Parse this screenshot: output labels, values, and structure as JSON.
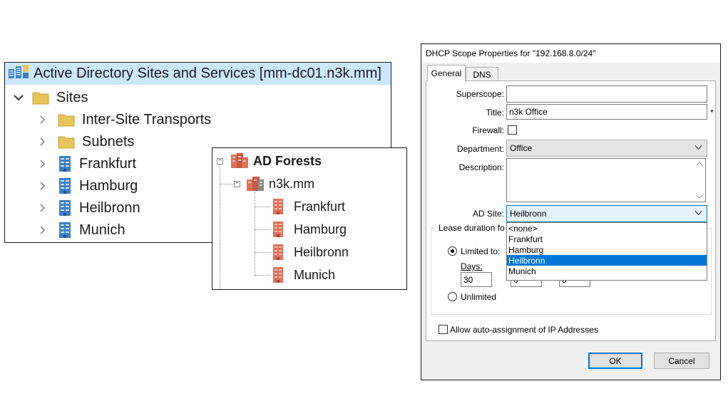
{
  "ads": {
    "title": "Active Directory Sites and Services [mm-dc01.n3k.mm]",
    "root": "Sites",
    "items": [
      {
        "label": "Inter-Site Transports",
        "icon": "folder-icon"
      },
      {
        "label": "Subnets",
        "icon": "folder-icon"
      },
      {
        "label": "Frankfurt",
        "icon": "site-icon"
      },
      {
        "label": "Hamburg",
        "icon": "site-icon"
      },
      {
        "label": "Heilbronn",
        "icon": "site-icon"
      },
      {
        "label": "Munich",
        "icon": "site-icon"
      }
    ]
  },
  "forest": {
    "title": "AD Forests",
    "domain": "n3k.mm",
    "sites": [
      "Frankfurt",
      "Hamburg",
      "Heilbronn",
      "Munich"
    ]
  },
  "dhcp": {
    "title": "DHCP Scope Properties for \"192.168.8.0/24\"",
    "tabs": [
      "General",
      "DNS"
    ],
    "superscope_label": "Superscope:",
    "superscope_value": "",
    "title_label": "Title:",
    "title_value": "n3k Office",
    "required_mark": "*",
    "firewall_label": "Firewall:",
    "department_label": "Department:",
    "department_value": "Office",
    "description_label": "Description:",
    "description_value": "",
    "adsite_label": "AD Site:",
    "adsite_value": "Heilbronn",
    "adsite_options": [
      "<none>",
      "Frankfurt",
      "Hamburg",
      "Heilbronn",
      "Munich"
    ],
    "adsite_selected_index": 3,
    "lease_group_label": "Lease duration fo",
    "limited_label": "Limited to:",
    "days_label": "Days:",
    "days_value": "30",
    "hours_value": "0",
    "minutes_value": "0",
    "unlimited_label": "Unlimited",
    "auto_assign_label": "Allow auto-assignment of IP Addresses",
    "ok_label": "OK",
    "cancel_label": "Cancel"
  },
  "colors": {
    "selection_blue": "#cce8ff",
    "list_highlight": "#0078d7",
    "folder_yellow": "#e8c35a",
    "site_blue": "#3c7fc4",
    "forest_red": "#e0705a"
  }
}
